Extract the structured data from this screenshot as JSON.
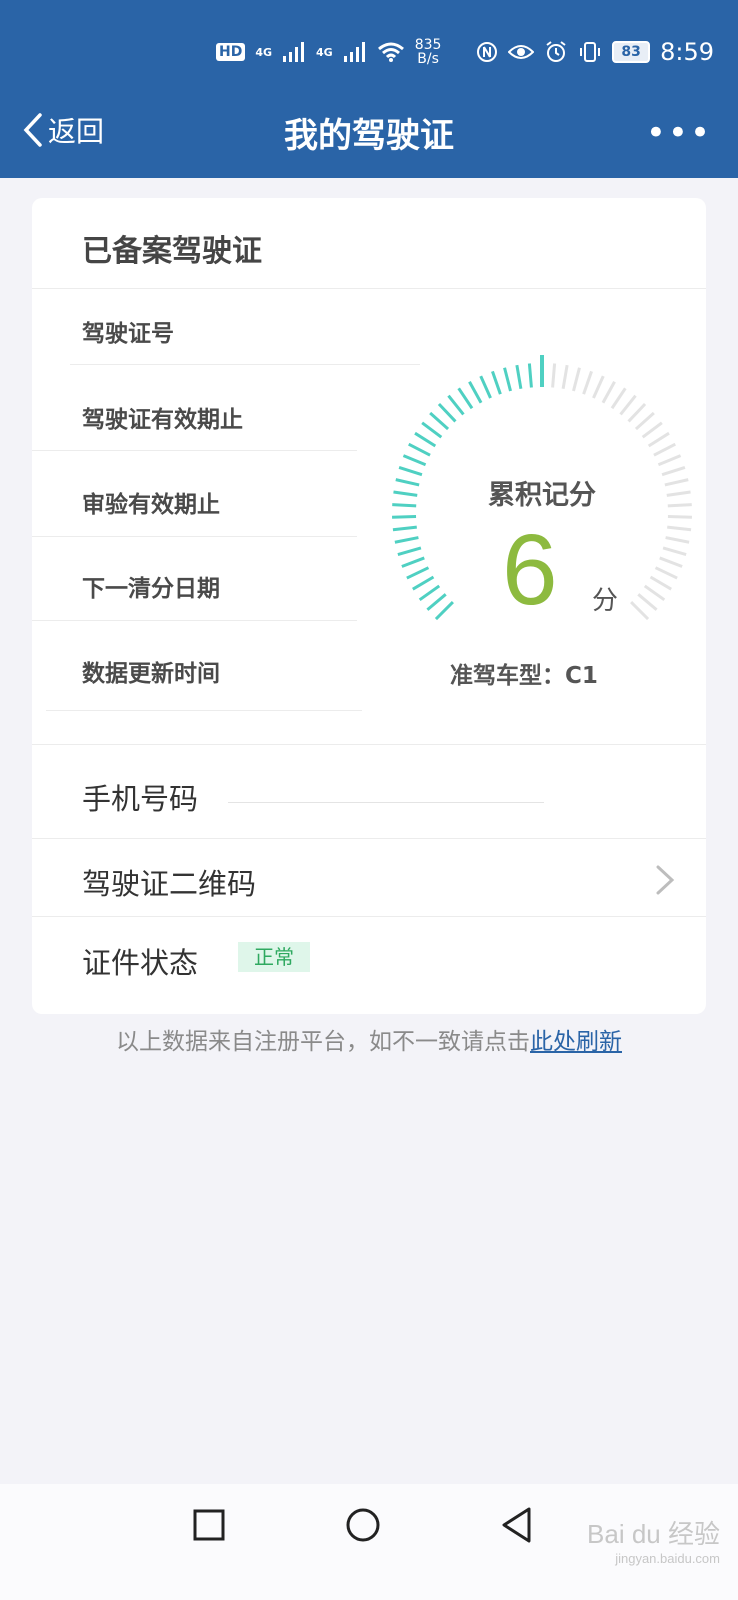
{
  "status_bar": {
    "hd": "HD",
    "signal1": "4G",
    "signal2": "4G",
    "net_speed_value": "835",
    "net_speed_unit": "B/s",
    "battery": "83",
    "time": "8:59"
  },
  "nav": {
    "back_label": "返回",
    "title": "我的驾驶证",
    "more": "•••"
  },
  "card": {
    "title": "已备案驾驶证",
    "info_rows": [
      "驾驶证号",
      "驾驶证有效期止",
      "审验有效期止",
      "下一清分日期",
      "数据更新时间"
    ],
    "gauge": {
      "label": "累积记分",
      "value": "6",
      "unit": "分",
      "fill_fraction": 0.5,
      "fill_color": "#4fd0c2",
      "track_color": "#e3e3e3"
    },
    "vehicle_type": "准驾车型：C1",
    "phone_label": "手机号码",
    "qrcode_label": "驾驶证二维码",
    "status_label": "证件状态",
    "status_value": "正常"
  },
  "footer": {
    "note": "以上数据来自注册平台，如不一致请点击",
    "refresh_link": "此处刷新"
  },
  "watermark": {
    "brand": "Bai du 经验",
    "url": "jingyan.baidu.com"
  }
}
